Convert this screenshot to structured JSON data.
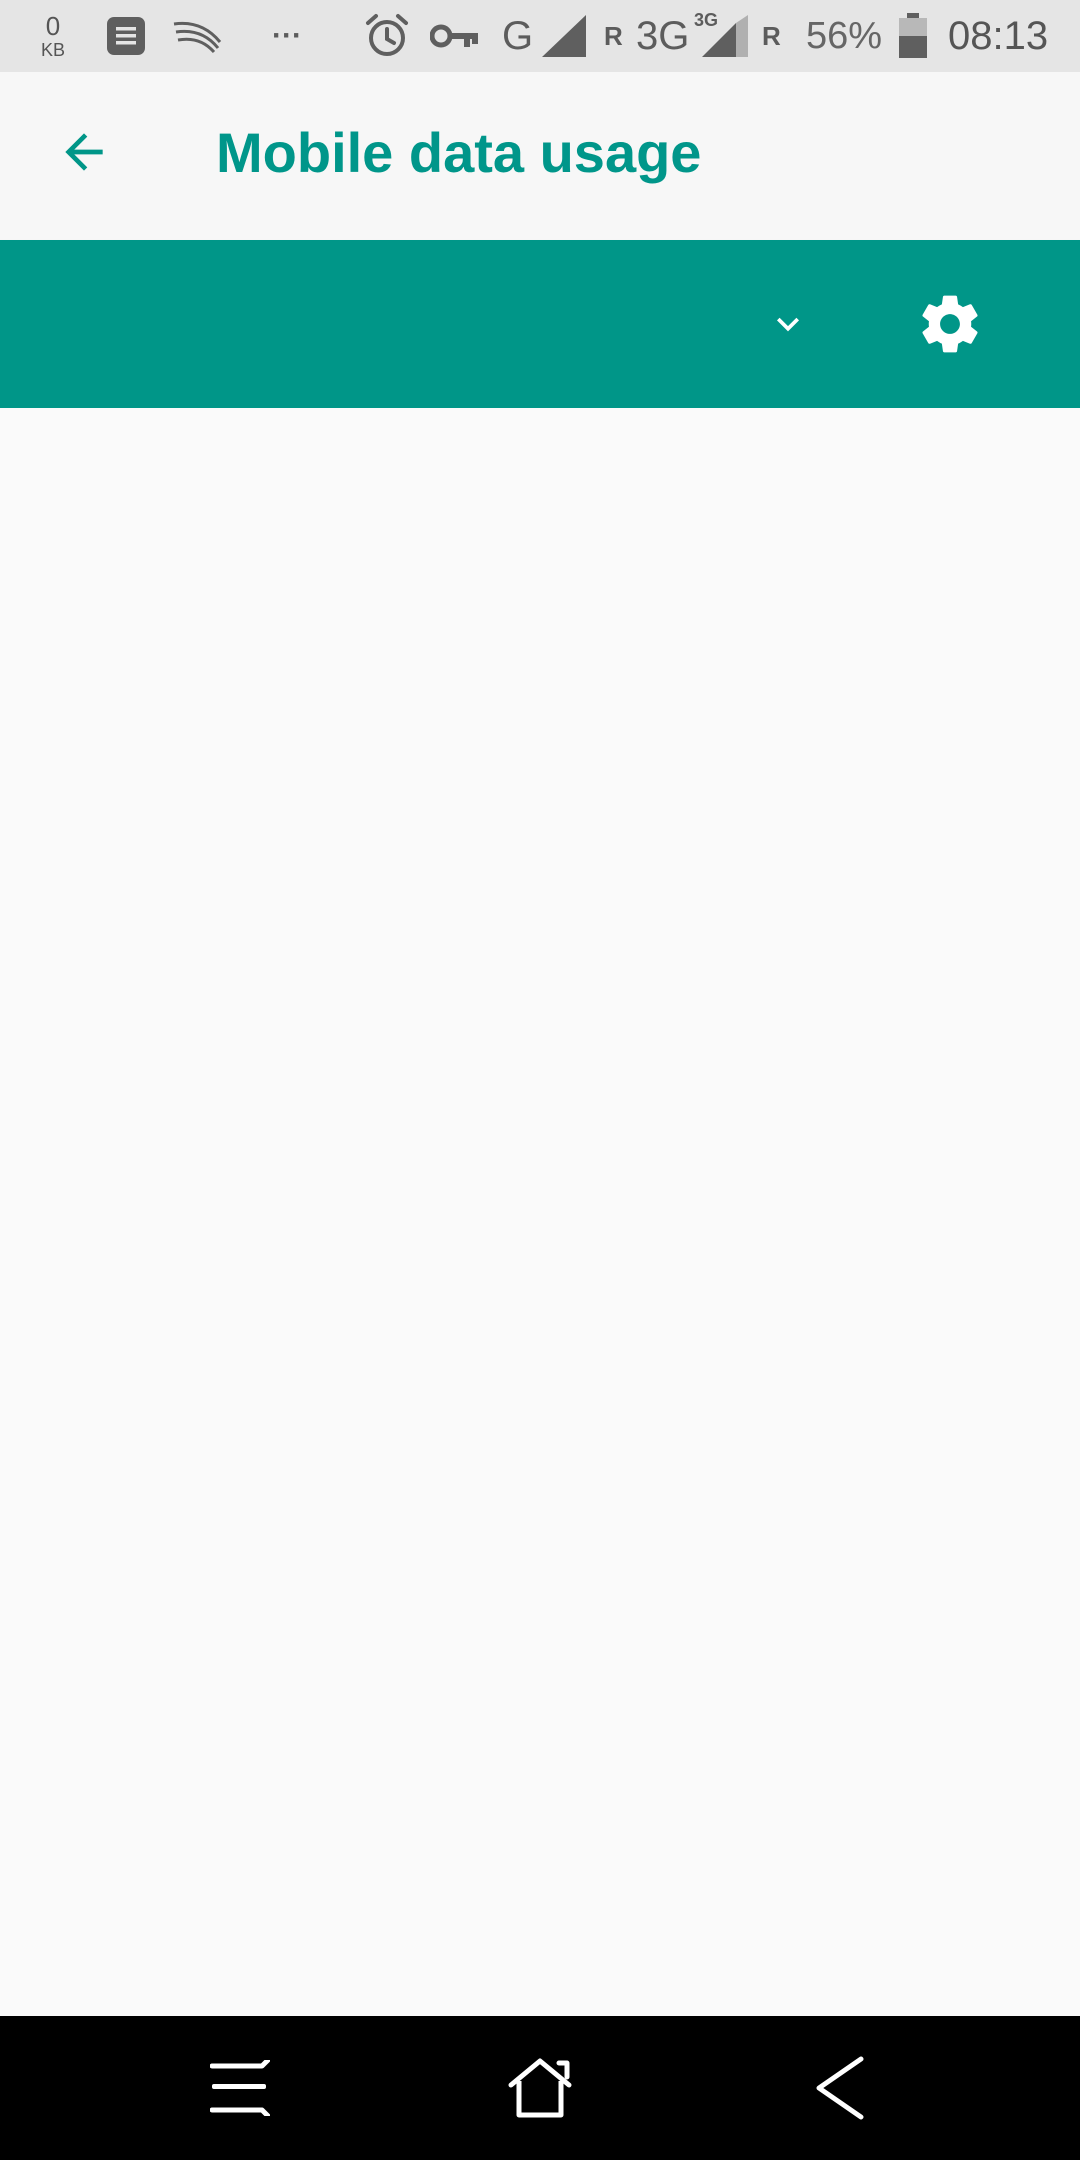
{
  "status_bar": {
    "data_counter_value": "0",
    "data_counter_unit": "KB",
    "overflow_dots": "···",
    "network_1": "G",
    "roaming_1": "R",
    "network_2": "3G",
    "network_2_badge": "3G",
    "roaming_2": "R",
    "battery_percent": "56%",
    "time": "08:13",
    "icons": [
      "notes-icon",
      "swiftkey-icon",
      "alarm-icon",
      "vpn-key-icon",
      "signal-icon",
      "battery-icon"
    ]
  },
  "app_bar": {
    "title": "Mobile data usage",
    "back_icon": "arrow-back-icon"
  },
  "cycle_bar": {
    "dropdown_icon": "chevron-down-icon",
    "settings_icon": "gear-icon"
  },
  "nav_bar": {
    "icons": [
      "recents-icon",
      "home-icon",
      "back-icon"
    ]
  },
  "colors": {
    "accent": "#009688",
    "title": "#00968A",
    "status_bar_bg": "#E5E5E5",
    "app_bar_bg": "#F7F7F7",
    "content_bg": "#FAFAFA",
    "nav_bar_bg": "#000000"
  }
}
